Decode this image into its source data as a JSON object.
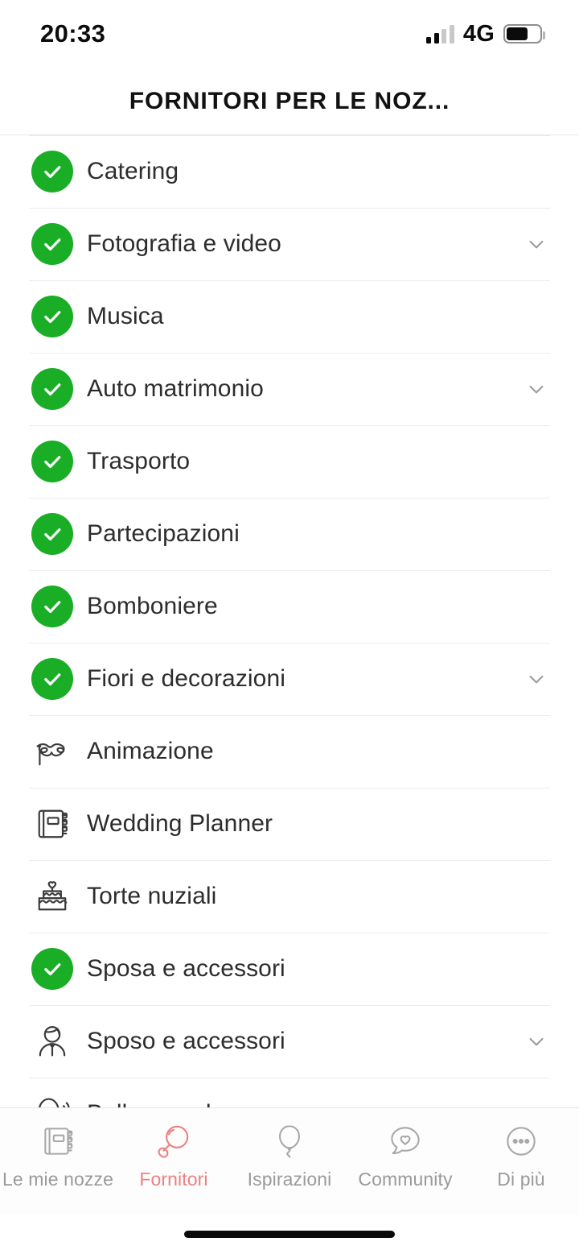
{
  "status_bar": {
    "time": "20:33",
    "network": "4G",
    "signal_bars_filled": 2,
    "signal_bars_total": 4,
    "battery_percent": 65
  },
  "header": {
    "title": "FORNITORI PER LE NOZ..."
  },
  "list": {
    "items": [
      {
        "label": "Catering",
        "icon": "check-circle-icon",
        "selected": true,
        "chevron": false
      },
      {
        "label": "Fotografia e video",
        "icon": "check-circle-icon",
        "selected": true,
        "chevron": true
      },
      {
        "label": "Musica",
        "icon": "check-circle-icon",
        "selected": true,
        "chevron": false
      },
      {
        "label": "Auto matrimonio",
        "icon": "check-circle-icon",
        "selected": true,
        "chevron": true
      },
      {
        "label": "Trasporto",
        "icon": "check-circle-icon",
        "selected": true,
        "chevron": false
      },
      {
        "label": "Partecipazioni",
        "icon": "check-circle-icon",
        "selected": true,
        "chevron": false
      },
      {
        "label": "Bomboniere",
        "icon": "check-circle-icon",
        "selected": true,
        "chevron": false
      },
      {
        "label": "Fiori e decorazioni",
        "icon": "check-circle-icon",
        "selected": true,
        "chevron": true
      },
      {
        "label": "Animazione",
        "icon": "carnival-mask-icon",
        "selected": false,
        "chevron": false
      },
      {
        "label": "Wedding Planner",
        "icon": "notebook-icon",
        "selected": false,
        "chevron": false
      },
      {
        "label": "Torte nuziali",
        "icon": "wedding-cake-icon",
        "selected": false,
        "chevron": false
      },
      {
        "label": "Sposa e accessori",
        "icon": "check-circle-icon",
        "selected": true,
        "chevron": false
      },
      {
        "label": "Sposo e accessori",
        "icon": "groom-icon",
        "selected": false,
        "chevron": true
      },
      {
        "label": "Bellezza e benessere",
        "icon": "beauty-mirror-icon",
        "selected": false,
        "chevron": true
      }
    ]
  },
  "tabbar": {
    "items": [
      {
        "label": "Le mie nozze",
        "icon": "notebook-icon",
        "active": false
      },
      {
        "label": "Fornitori",
        "icon": "magnifier-icon",
        "active": true
      },
      {
        "label": "Ispirazioni",
        "icon": "balloon-icon",
        "active": false
      },
      {
        "label": "Community",
        "icon": "speech-bubble-heart-icon",
        "active": false
      },
      {
        "label": "Di più",
        "icon": "more-dots-circle-icon",
        "active": false
      }
    ]
  },
  "colors": {
    "selected_green": "#1aae27",
    "active_accent": "#ee8080",
    "inactive_grey": "#9a9a9a",
    "divider": "#ececec",
    "text": "#2d2d2d"
  }
}
